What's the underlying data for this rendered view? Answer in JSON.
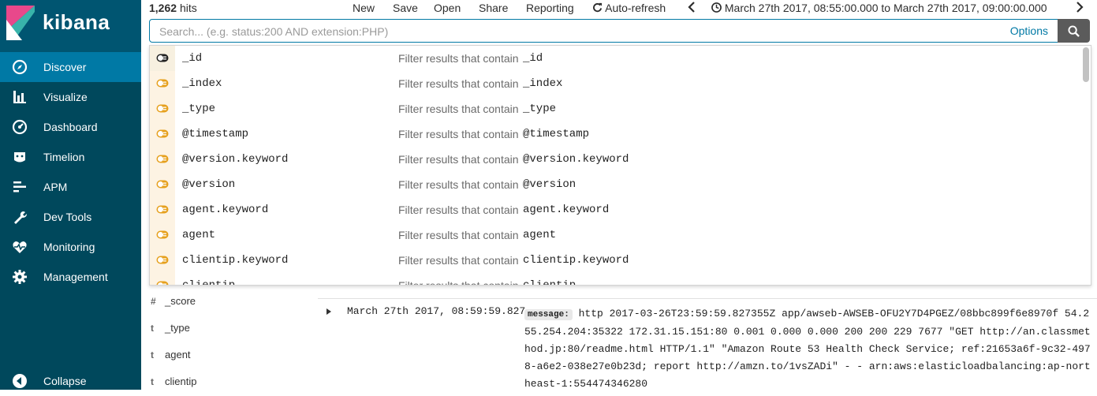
{
  "sidebar": {
    "brand": "kibana",
    "items": [
      {
        "label": "Discover",
        "icon": "compass-icon",
        "active": true
      },
      {
        "label": "Visualize",
        "icon": "bar-chart-icon",
        "active": false
      },
      {
        "label": "Dashboard",
        "icon": "dashboard-icon",
        "active": false
      },
      {
        "label": "Timelion",
        "icon": "timelion-icon",
        "active": false
      },
      {
        "label": "APM",
        "icon": "apm-icon",
        "active": false
      },
      {
        "label": "Dev Tools",
        "icon": "wrench-icon",
        "active": false
      },
      {
        "label": "Monitoring",
        "icon": "heartbeat-icon",
        "active": false
      },
      {
        "label": "Management",
        "icon": "gear-icon",
        "active": false
      }
    ],
    "collapse_label": "Collapse"
  },
  "topbar": {
    "hits_count": "1,262",
    "hits_label": "hits",
    "new": "New",
    "save": "Save",
    "open": "Open",
    "share": "Share",
    "reporting": "Reporting",
    "auto_refresh": "Auto-refresh",
    "time_range": "March 27th 2017, 08:55:00.000 to March 27th 2017, 09:00:00.000"
  },
  "search": {
    "placeholder": "Search... (e.g. status:200 AND extension:PHP)",
    "value": "",
    "options_label": "Options"
  },
  "suggestions": {
    "description_prefix": "Filter results that contain",
    "items": [
      {
        "field": "_id"
      },
      {
        "field": "_index"
      },
      {
        "field": "_type"
      },
      {
        "field": "@timestamp"
      },
      {
        "field": "@version.keyword"
      },
      {
        "field": "@version"
      },
      {
        "field": "agent.keyword"
      },
      {
        "field": "agent"
      },
      {
        "field": "clientip.keyword"
      },
      {
        "field": "clientip"
      }
    ]
  },
  "fieldlist": [
    {
      "type": "#",
      "name": "_score"
    },
    {
      "type": "t",
      "name": "_type"
    },
    {
      "type": "t",
      "name": "agent"
    },
    {
      "type": "t",
      "name": "clientip"
    }
  ],
  "document": {
    "time": "March 27th 2017, 08:59:59.827",
    "message_label": "message:",
    "message": "http 2017-03-26T23:59:59.827355Z app/awseb-AWSEB-OFU2Y7D4PGEZ/08bbc899f6e8970f 54.255.254.204:35322 172.31.15.151:80 0.001 0.000 0.000 200 200 229 7677 \"GET http://an.classmethod.jp:80/readme.html HTTP/1.1\" \"Amazon Route 53 Health Check Service; ref:21653a6f-9c32-4978-a6e2-038e27e0b23d; report http://amzn.to/1vsZADi\" - - arn:aws:elasticloadbalancing:ap-northeast-1:554474346280"
  },
  "colors": {
    "sidebar_bg": "#00485c",
    "sidebar_active": "#0079a5",
    "accent": "#0079a5",
    "field_icon": "#e6a01d"
  }
}
